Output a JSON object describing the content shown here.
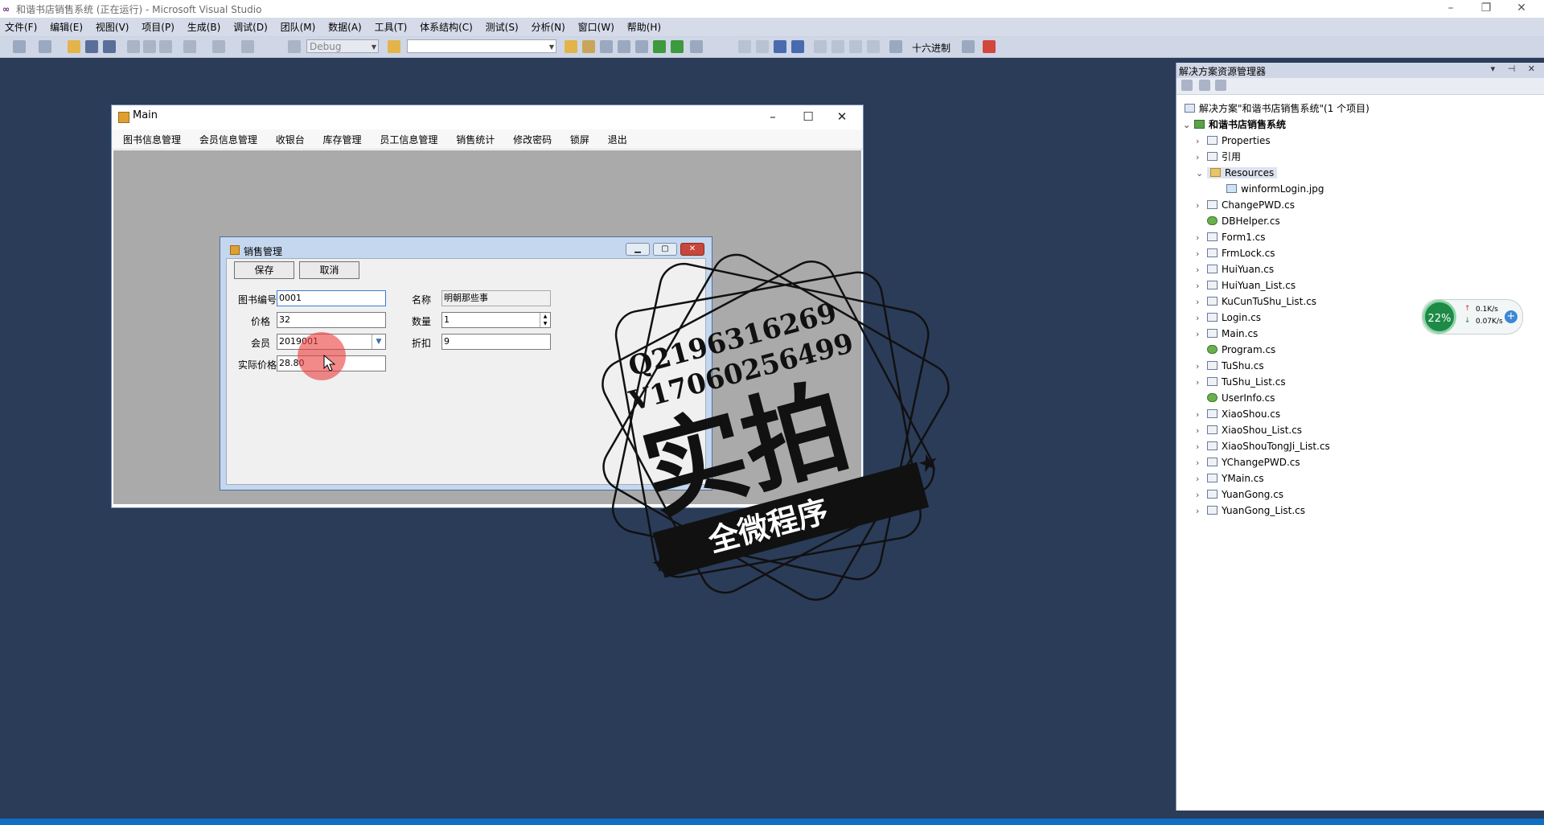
{
  "window": {
    "title": "和谐书店销售系统 (正在运行) - Microsoft Visual Studio"
  },
  "menubar": [
    "文件(F)",
    "编辑(E)",
    "视图(V)",
    "项目(P)",
    "生成(B)",
    "调试(D)",
    "团队(M)",
    "数据(A)",
    "工具(T)",
    "体系结构(C)",
    "测试(S)",
    "分析(N)",
    "窗口(W)",
    "帮助(H)"
  ],
  "toolbar": {
    "config": "Debug",
    "hex_label": "十六进制"
  },
  "mainwin": {
    "title": "Main",
    "menu": [
      "图书信息管理",
      "会员信息管理",
      "收银台",
      "库存管理",
      "员工信息管理",
      "销售统计",
      "修改密码",
      "锁屏",
      "退出"
    ]
  },
  "sales_form": {
    "title": "销售管理",
    "save_label": "保存",
    "cancel_label": "取消",
    "book_no_label": "图书编号",
    "book_no": "0001",
    "name_label": "名称",
    "name": "明朝那些事",
    "price_label": "价格",
    "price": "32",
    "qty_label": "数量",
    "qty": "1",
    "member_label": "会员",
    "member": "2019001",
    "discount_label": "折扣",
    "discount": "9",
    "actual_label": "实际价格",
    "actual": "28.80"
  },
  "solution_explorer": {
    "title": "解决方案资源管理器",
    "solution": "解决方案\"和谐书店销售系统\"(1 个项目)",
    "project": "和谐书店销售系统",
    "items": [
      "Properties",
      "引用",
      "Resources",
      "winformLogin.jpg",
      "ChangePWD.cs",
      "DBHelper.cs",
      "Form1.cs",
      "FrmLock.cs",
      "HuiYuan.cs",
      "HuiYuan_List.cs",
      "KuCunTuShu_List.cs",
      "Login.cs",
      "Main.cs",
      "Program.cs",
      "TuShu.cs",
      "TuShu_List.cs",
      "UserInfo.cs",
      "XiaoShou.cs",
      "XiaoShou_List.cs",
      "XiaoShouTongJi_List.cs",
      "YChangePWD.cs",
      "YMain.cs",
      "YuanGong.cs",
      "YuanGong_List.cs"
    ]
  },
  "net_widget": {
    "percent": "22%",
    "up": "0.1K/s",
    "down": "0.07K/s"
  },
  "watermark": {
    "line1": "Q2196316269",
    "line2": "V17060256499",
    "big": "实拍",
    "banner": "全微程序"
  }
}
